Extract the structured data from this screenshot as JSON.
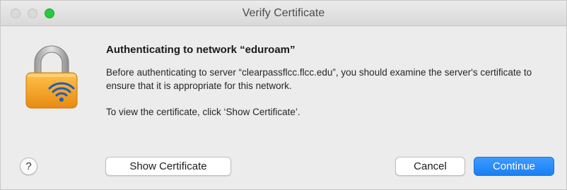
{
  "window": {
    "title": "Verify Certificate"
  },
  "dialog": {
    "icon": "lock-wifi-icon",
    "heading": "Authenticating to network “eduroam”",
    "message": "Before authenticating to server “clearpassflcc.flcc.edu”, you should examine the server's certificate to ensure that it is appropriate for this network.",
    "hint": "To view the certificate, click ‘Show Certificate’."
  },
  "buttons": {
    "help_label": "?",
    "show_certificate": "Show Certificate",
    "cancel": "Cancel",
    "continue": "Continue"
  },
  "colors": {
    "accent": "#1a7ff3",
    "lock_body": "#f5a623",
    "zoom_button": "#29c940"
  }
}
